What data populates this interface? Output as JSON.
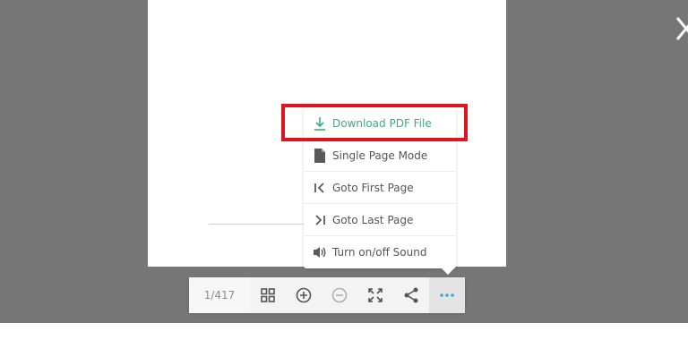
{
  "menu": {
    "items": [
      {
        "label": "Download PDF File",
        "icon": "download-icon"
      },
      {
        "label": "Single Page Mode",
        "icon": "document-icon"
      },
      {
        "label": "Goto First Page",
        "icon": "first-page-icon"
      },
      {
        "label": "Goto Last Page",
        "icon": "last-page-icon"
      },
      {
        "label": "Turn on/off Sound",
        "icon": "sound-icon"
      }
    ]
  },
  "toolbar": {
    "page_indicator": "1/417",
    "buttons": [
      "thumbnails-icon",
      "zoom-in-icon",
      "zoom-out-icon",
      "fullscreen-icon",
      "share-icon",
      "more-icon"
    ]
  },
  "colors": {
    "backdrop": "#767676",
    "accent": "#3bae7a",
    "highlight": "#e0141e",
    "more_icon": "#3aa7d9"
  }
}
